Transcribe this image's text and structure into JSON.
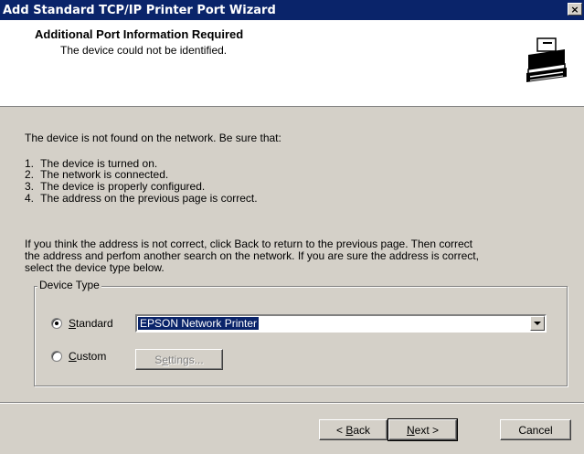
{
  "window": {
    "title": "Add Standard TCP/IP Printer Port Wizard",
    "close_glyph": "×"
  },
  "header": {
    "title": "Additional Port Information Required",
    "subtitle": "The device could not be identified.",
    "icon": "printer-wizard-icon"
  },
  "body": {
    "intro": "The device is not found on the network.  Be sure that:",
    "checklist": [
      {
        "num": "1.",
        "text": "The device is turned on."
      },
      {
        "num": "2.",
        "text": "The network is connected."
      },
      {
        "num": "3.",
        "text": "The device is properly configured."
      },
      {
        "num": "4.",
        "text": "The address on the previous page is correct."
      }
    ],
    "instructions_lines": [
      "If you think the address is not correct, click Back to return to the previous page.  Then correct",
      "the address and perfom another search on the network.  If you are sure the address is correct,",
      "select the device type below."
    ]
  },
  "device_type": {
    "legend": "Device Type",
    "standard_label_pre": "",
    "standard_label_ul": "S",
    "standard_label_post": "tandard",
    "standard_selected": true,
    "standard_value": "EPSON Network Printer",
    "custom_label_ul": "C",
    "custom_label_post": "ustom",
    "custom_selected": false,
    "settings_label_pre": "S",
    "settings_label_ul": "e",
    "settings_label_post": "ttings..."
  },
  "buttons": {
    "back_pre": "< ",
    "back_ul": "B",
    "back_post": "ack",
    "next_ul": "N",
    "next_post": "ext >",
    "cancel": "Cancel"
  }
}
